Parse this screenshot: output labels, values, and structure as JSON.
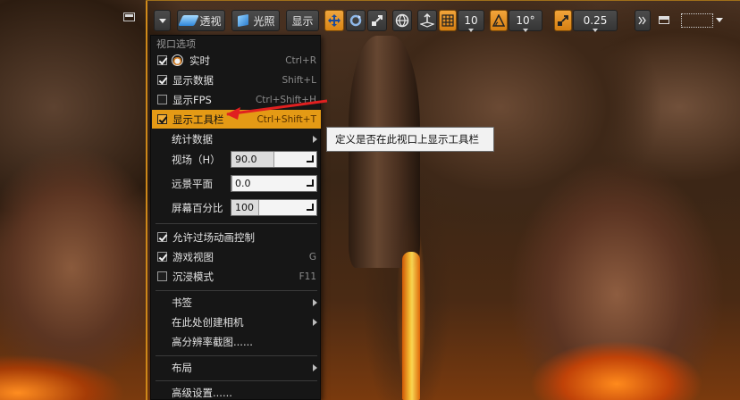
{
  "toolbar": {
    "perspective_label": "透视",
    "lit_label": "光照",
    "show_label": "显示",
    "grid_snap_value": "10",
    "rotation_snap_value": "10°",
    "scale_snap_value": "0.25"
  },
  "menu": {
    "header": "视口选项",
    "items": {
      "realtime": {
        "label": "实时",
        "shortcut": "Ctrl+R",
        "checked": true
      },
      "show_stats": {
        "label": "显示数据",
        "shortcut": "Shift+L",
        "checked": true
      },
      "show_fps": {
        "label": "显示FPS",
        "shortcut": "Ctrl+Shift+H",
        "checked": false
      },
      "show_toolbar": {
        "label": "显示工具栏",
        "shortcut": "Ctrl+Shift+T",
        "checked": true
      },
      "stat": {
        "label": "统计数据"
      },
      "fov": {
        "label": "视场（H）",
        "value": "90.0",
        "fill_fraction": 0.5
      },
      "far_plane": {
        "label": "远景平面",
        "value": "0.0",
        "fill_fraction": 0.0
      },
      "screen_pct": {
        "label": "屏幕百分比",
        "value": "100",
        "fill_fraction": 0.33
      },
      "allow_cinematic": {
        "label": "允许过场动画控制",
        "checked": true
      },
      "game_view": {
        "label": "游戏视图",
        "shortcut": "G",
        "checked": true
      },
      "immersive": {
        "label": "沉浸模式",
        "shortcut": "F11",
        "checked": false
      },
      "bookmarks": {
        "label": "书签"
      },
      "create_camera": {
        "label": "在此处创建相机"
      },
      "hires_shot": {
        "label": "高分辨率截图......"
      },
      "layouts": {
        "label": "布局"
      },
      "advanced": {
        "label": "高级设置......"
      }
    }
  },
  "tooltip": {
    "text": "定义是否在此视口上显示工具栏"
  },
  "colors": {
    "accent": "#e49a15",
    "arrow": "#e02020"
  }
}
